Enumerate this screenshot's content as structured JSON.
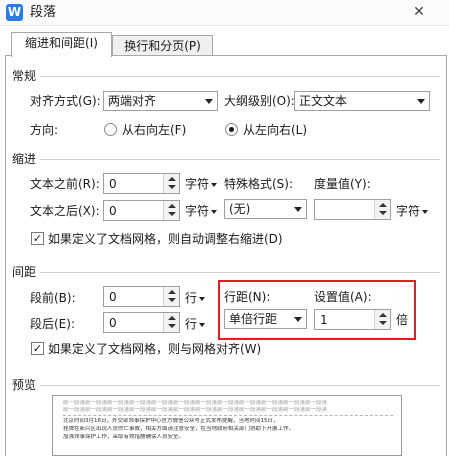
{
  "window": {
    "title": "段落",
    "app_icon_letter": "W",
    "close_glyph": "✕"
  },
  "tabs": [
    {
      "label": "缩进和间距(I)",
      "active": true
    },
    {
      "label": "换行和分页(P)",
      "active": false
    }
  ],
  "general": {
    "header": "常规",
    "alignment_label": "对齐方式(G):",
    "alignment_value": "两端对齐",
    "outline_label": "大纲级别(O):",
    "outline_value": "正文文本",
    "direction_label": "方向:",
    "rtl_label": "从右向左(F)",
    "ltr_label": "从左向右(L)",
    "selected_direction": "ltr"
  },
  "indent": {
    "header": "缩进",
    "before_label": "文本之前(R):",
    "before_value": "0",
    "before_unit": "字符",
    "after_label": "文本之后(X):",
    "after_value": "0",
    "after_unit": "字符",
    "special_label": "特殊格式(S):",
    "special_value": "(无)",
    "measure_label": "度量值(Y):",
    "measure_value": "",
    "measure_unit": "字符",
    "grid_checkbox_label": "如果定义了文档网格，则自动调整右缩进(D)",
    "grid_checked": true
  },
  "spacing": {
    "header": "间距",
    "before_label": "段前(B):",
    "before_value": "0",
    "before_unit": "行",
    "after_label": "段后(E):",
    "after_value": "0",
    "after_unit": "行",
    "line_spacing_label": "行距(N):",
    "line_spacing_value": "单倍行距",
    "setting_label": "设置值(A):",
    "setting_value": "1",
    "setting_unit": "倍",
    "grid_checkbox_label": "如果定义了文档网格，则与网格对齐(W)",
    "grid_checked": true
  },
  "preview": {
    "header": "预览",
    "lines": [
      "前一段落前一段落前一段落前一段落前一段落前一段落前一段落前一段落前一段落前一段落前一段落前一段落",
      "前一段落前一段落前一段落前一段落前一段落前一段落前一段落前一段落前一段落前一段落前一段落前一段落",
      "北京时间3月16日，外交部领事保护中心官方微信公众号正式发布提醒，当地时间15日，",
      "挂牌在新兴区出现人员伤亡事故，相关方面请注意安全，在当地政府相关部门协助下开展工作，",
      "加强领事保护工作，采取有效措施确保人员安全。"
    ]
  },
  "colors": {
    "highlight_border": "#e02020",
    "app_icon_bg": "#2f7ce0"
  }
}
